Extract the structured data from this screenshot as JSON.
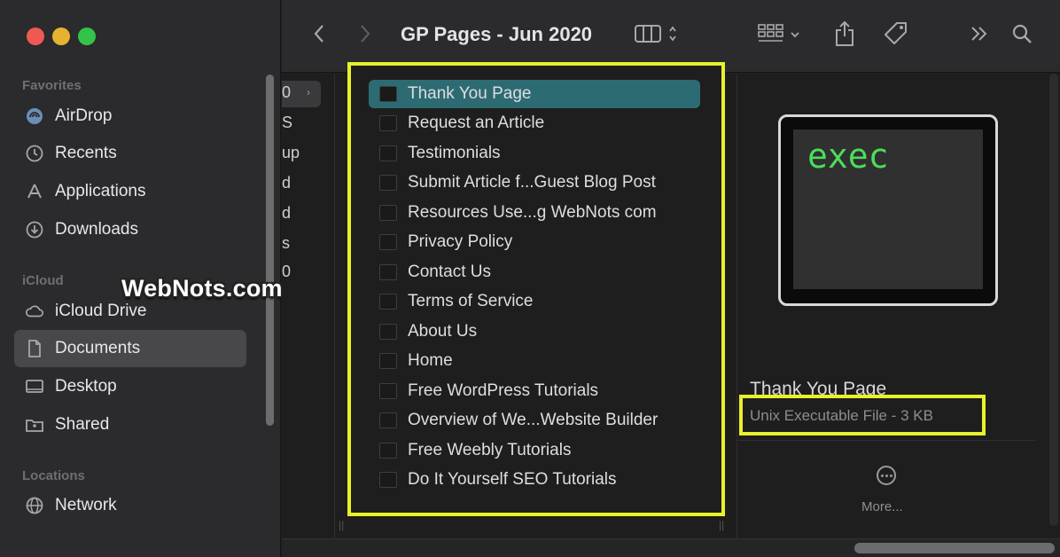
{
  "window": {
    "title": "GP Pages - Jun 2020"
  },
  "sidebar": {
    "sections": [
      {
        "label": "Favorites"
      },
      {
        "label": "iCloud"
      },
      {
        "label": "Locations"
      }
    ],
    "items": [
      {
        "label": "AirDrop",
        "icon": "airdrop-icon"
      },
      {
        "label": "Recents",
        "icon": "clock-icon"
      },
      {
        "label": "Applications",
        "icon": "applications-icon"
      },
      {
        "label": "Downloads",
        "icon": "download-icon"
      },
      {
        "label": "iCloud Drive",
        "icon": "cloud-icon"
      },
      {
        "label": "Documents",
        "icon": "document-icon",
        "selected": true
      },
      {
        "label": "Desktop",
        "icon": "desktop-icon"
      },
      {
        "label": "Shared",
        "icon": "shared-folder-icon"
      },
      {
        "label": "Network",
        "icon": "globe-icon"
      }
    ]
  },
  "watermark": {
    "text": "WebNots.com"
  },
  "previous_column": {
    "rows": [
      "0",
      "S",
      "up",
      "d",
      "d",
      "s",
      "0"
    ]
  },
  "files": [
    "Thank You Page",
    "Request an Article",
    "Testimonials",
    "Submit Article f...Guest Blog Post",
    "Resources Use...g WebNots com",
    "Privacy Policy",
    "Contact Us",
    "Terms of Service",
    "About Us",
    "Home",
    "Free WordPress Tutorials",
    "Overview of We...Website Builder",
    "Free Weebly Tutorials",
    "Do It Yourself SEO Tutorials"
  ],
  "preview": {
    "thumbnail_text": "exec",
    "file_name": "Thank You Page",
    "file_type": "Unix Executable File - 3 KB",
    "more_label": "More..."
  },
  "colors": {
    "highlight_box": "#e8f12a",
    "selection": "#2d6b73",
    "exec_text": "#4ade5a"
  }
}
